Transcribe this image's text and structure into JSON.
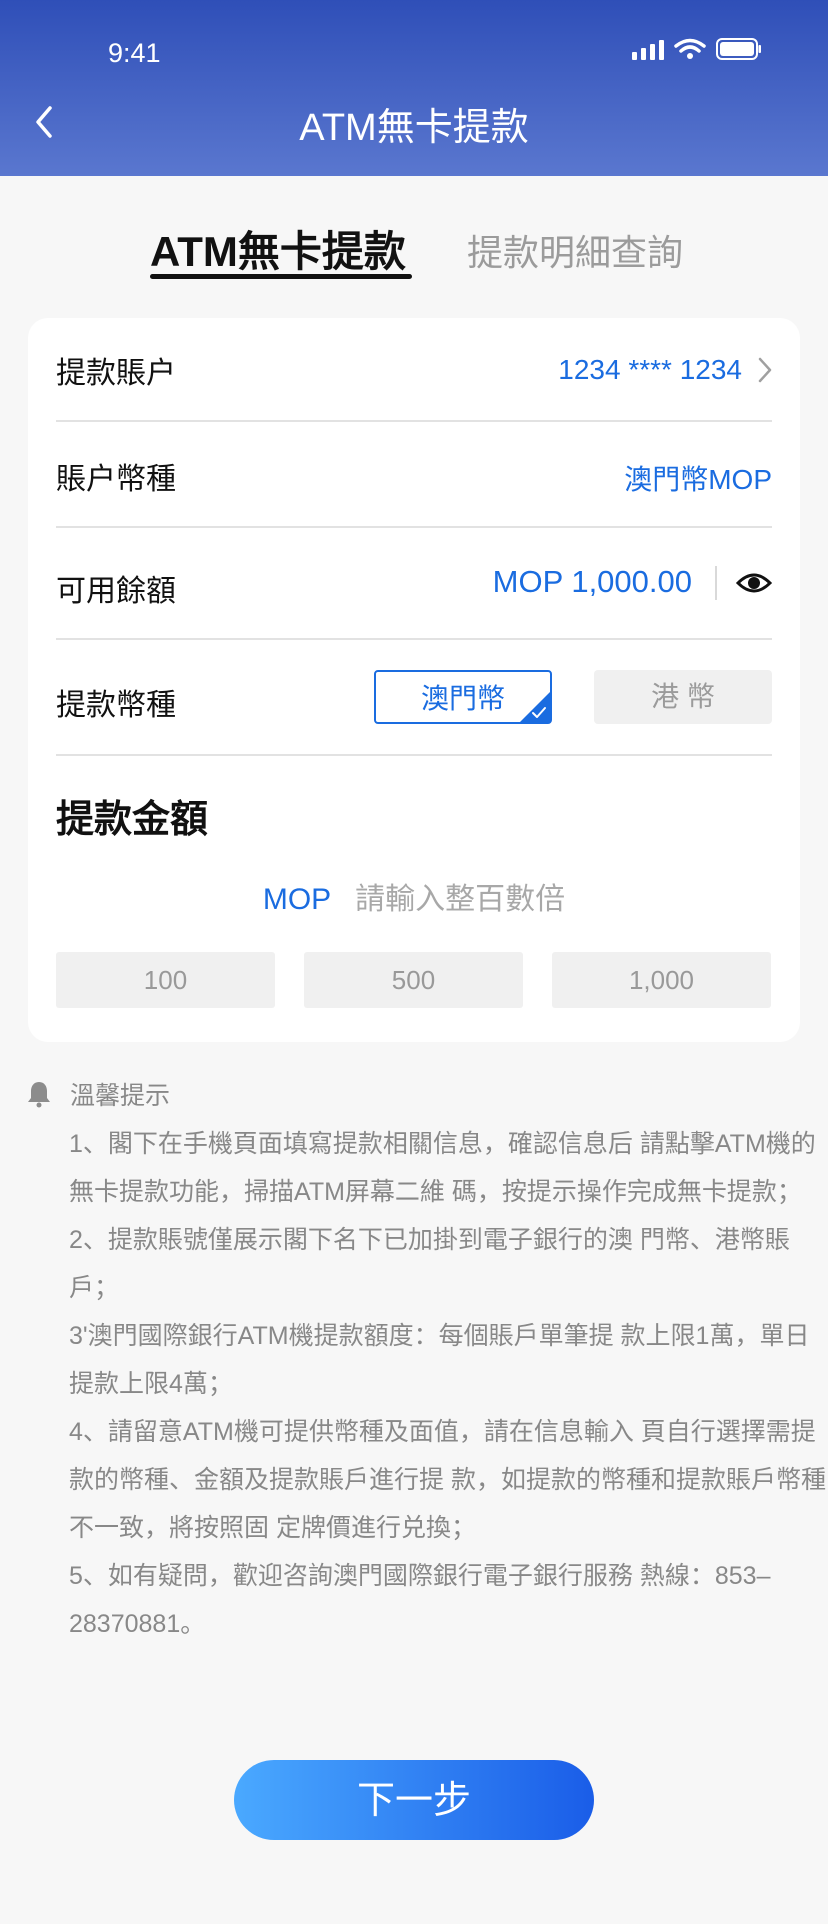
{
  "status": {
    "time": "9:41"
  },
  "header": {
    "title": "ATM無卡提款"
  },
  "tabs": {
    "active": "ATM無卡提款",
    "inactive": "提款明細查詢"
  },
  "form": {
    "account_label": "提款賬户",
    "account_value": "1234 **** 1234",
    "currency_label": "賬户幣種",
    "currency_value": "澳門幣MOP",
    "balance_label": "可用餘額",
    "balance_value": "MOP 1,000.00",
    "withdraw_currency_label": "提款幣種",
    "currency_options": [
      "澳門幣",
      "港 幣"
    ],
    "selected_currency": "澳門幣",
    "amount_title": "提款金額",
    "amount_currency": "MOP",
    "amount_placeholder": "請輸入整百數倍",
    "quick_amounts": [
      "100",
      "500",
      "1,000"
    ]
  },
  "notice": {
    "title": "溫馨提示",
    "lines": [
      "1、閣下在手機頁面填寫提款相關信息，確認信息后 請點擊ATM機的無卡提款功能，掃描ATM屏幕二維 碼，按提示操作完成無卡提款；",
      "2、提款賬號僅展示閣下名下已加掛到電子銀行的澳 門幣、港幣賬戶；",
      "3'澳門國際銀行ATM機提款額度：每個賬戶單筆提 款上限1萬，單日提款上限4萬；",
      "4、請留意ATM機可提供幣種及面值，請在信息輸入 頁自行選擇需提款的幣種、金額及提款賬戶進行提 款，如提款的幣種和提款賬戶幣種不一致，將按照固 定牌價進行兑換；",
      "5、如有疑問，歡迎咨詢澳門國際銀行電子銀行服務 熱線：853–28370881。"
    ]
  },
  "footer": {
    "next_label": "下一步"
  },
  "colors": {
    "accent": "#1a6ce0",
    "header_top": "#2f4fb8",
    "header_bottom": "#5a77cf"
  }
}
